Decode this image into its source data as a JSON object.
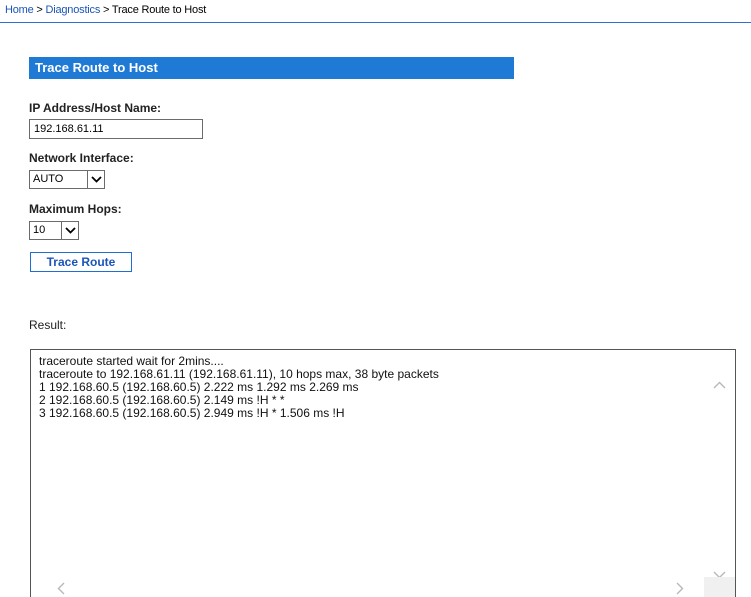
{
  "breadcrumb": {
    "home": "Home",
    "sep1": " > ",
    "diagnostics": "Diagnostics",
    "sep2": " > ",
    "current": "Trace Route to Host"
  },
  "section": {
    "title": "Trace Route to Host"
  },
  "form": {
    "ip_label": "IP Address/Host Name:",
    "ip_value": "192.168.61.11",
    "interface_label": "Network Interface:",
    "interface_value": "AUTO",
    "hops_label": "Maximum Hops:",
    "hops_value": "10",
    "trace_button": "Trace Route"
  },
  "result": {
    "label": "Result:",
    "lines": [
      "traceroute started wait for 2mins....",
      "traceroute to 192.168.61.11 (192.168.61.11), 10 hops max, 38 byte packets",
      "1 192.168.60.5 (192.168.60.5) 2.222 ms 1.292 ms 2.269 ms",
      "2 192.168.60.5 (192.168.60.5) 2.149 ms !H * *",
      "3 192.168.60.5 (192.168.60.5) 2.949 ms !H * 1.506 ms !H"
    ]
  },
  "colors": {
    "header_bg": "#1f7ad6",
    "link": "#1a55b8",
    "button_border": "#1e6fd0"
  },
  "icons": {
    "select_arrow": "chevron-down-icon",
    "scroll_up": "chevron-up-icon",
    "scroll_down": "chevron-down-icon",
    "scroll_left": "chevron-left-icon",
    "scroll_right": "chevron-right-icon"
  }
}
